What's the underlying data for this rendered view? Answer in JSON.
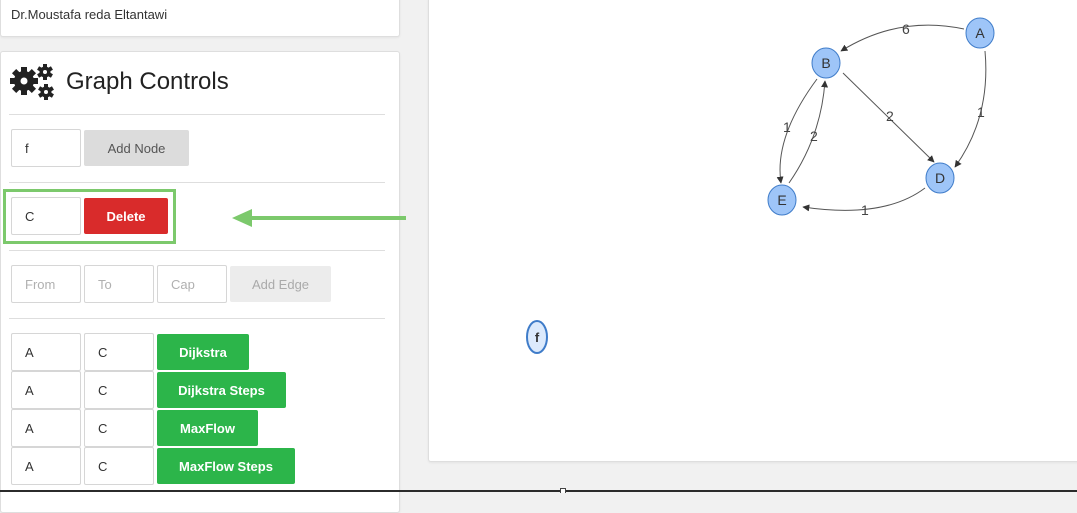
{
  "header": {
    "author": "Dr.Moustafa reda Eltantawi"
  },
  "controls": {
    "title": "Graph Controls",
    "add_node": {
      "value": "f",
      "button": "Add Node"
    },
    "delete_node": {
      "value": "C",
      "button": "Delete"
    },
    "add_edge": {
      "from_placeholder": "From",
      "to_placeholder": "To",
      "cap_placeholder": "Cap",
      "button": "Add Edge"
    },
    "algorithms": [
      {
        "from": "A",
        "to": "C",
        "button": "Dijkstra"
      },
      {
        "from": "A",
        "to": "C",
        "button": "Dijkstra Steps"
      },
      {
        "from": "A",
        "to": "C",
        "button": "MaxFlow"
      },
      {
        "from": "A",
        "to": "C",
        "button": "MaxFlow Steps"
      }
    ]
  },
  "annotation": {
    "arrow_color": "#7cc96c",
    "icon": "gears-icon"
  },
  "graph": {
    "node_fill": "#9ec5f8",
    "node_stroke": "#3f7cc9",
    "nodes": [
      "A",
      "B",
      "D",
      "E",
      "f"
    ],
    "edges": [
      {
        "from": "A",
        "to": "B",
        "label": "6"
      },
      {
        "from": "A",
        "to": "D",
        "label": "1"
      },
      {
        "from": "B",
        "to": "D",
        "label": "2"
      },
      {
        "from": "B",
        "to": "E",
        "label": "1"
      },
      {
        "from": "E",
        "to": "B",
        "label": "2"
      },
      {
        "from": "D",
        "to": "E",
        "label": "1"
      }
    ]
  }
}
